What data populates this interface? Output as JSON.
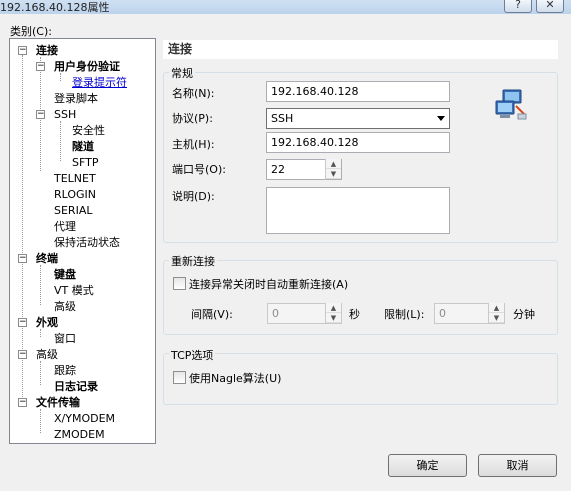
{
  "window": {
    "title": "192.168.40.128属性",
    "help_button": "?",
    "close_button": "✕"
  },
  "category_label": "类别(C):",
  "tree": {
    "items": [
      {
        "label": "连接",
        "bold": true
      },
      {
        "label": "用户身份验证",
        "bold": true
      },
      {
        "label": "登录提示符",
        "link": true
      },
      {
        "label": "登录脚本"
      },
      {
        "label": "SSH"
      },
      {
        "label": "安全性"
      },
      {
        "label": "隧道",
        "bold": true
      },
      {
        "label": "SFTP"
      },
      {
        "label": "TELNET"
      },
      {
        "label": "RLOGIN"
      },
      {
        "label": "SERIAL"
      },
      {
        "label": "代理"
      },
      {
        "label": "保持活动状态"
      },
      {
        "label": "终端",
        "bold": true
      },
      {
        "label": "键盘",
        "bold": true
      },
      {
        "label": "VT 模式"
      },
      {
        "label": "高级"
      },
      {
        "label": "外观",
        "bold": true
      },
      {
        "label": "窗口"
      },
      {
        "label": "高级"
      },
      {
        "label": "跟踪"
      },
      {
        "label": "日志记录",
        "bold": true
      },
      {
        "label": "文件传输",
        "bold": true
      },
      {
        "label": "X/YMODEM"
      },
      {
        "label": "ZMODEM"
      }
    ]
  },
  "panel": {
    "header": "连接",
    "general": {
      "title": "常规",
      "name_label": "名称(N):",
      "name_value": "192.168.40.128",
      "protocol_label": "协议(P):",
      "protocol_value": "SSH",
      "host_label": "主机(H):",
      "host_value": "192.168.40.128",
      "port_label": "端口号(O):",
      "port_value": "22",
      "desc_label": "说明(D):",
      "desc_value": "",
      "icon": "network-computers-icon"
    },
    "reconnect": {
      "title": "重新连接",
      "checkbox_label": "连接异常关闭时自动重新连接(A)",
      "interval_label": "间隔(V):",
      "interval_value": "0",
      "interval_unit": "秒",
      "limit_label": "限制(L):",
      "limit_value": "0",
      "limit_unit": "分钟"
    },
    "tcp": {
      "title": "TCP选项",
      "nagle_label": "使用Nagle算法(U)"
    }
  },
  "buttons": {
    "ok": "确定",
    "cancel": "取消"
  }
}
